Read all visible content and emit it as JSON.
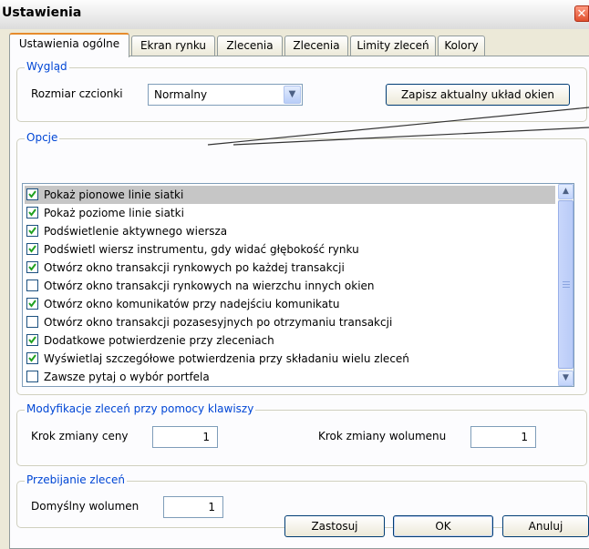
{
  "window": {
    "title": "Ustawienia",
    "close_glyph": "✕"
  },
  "tabs": [
    {
      "label": "Ustawienia ogólne",
      "active": true
    },
    {
      "label": "Ekran rynku",
      "active": false
    },
    {
      "label": "Zlecenia",
      "active": false
    },
    {
      "label": "Zlecenia",
      "active": false
    },
    {
      "label": "Limity zleceń",
      "active": false
    },
    {
      "label": "Kolory",
      "active": false
    }
  ],
  "wyglad": {
    "group_label": "Wygląd",
    "font_size_label": "Rozmiar czcionki",
    "font_size_value": "Normalny",
    "save_layout_label": "Zapisz aktualny układ okien"
  },
  "opcje": {
    "group_label": "Opcje",
    "items": [
      {
        "label": "Pokaż pionowe linie siatki",
        "checked": true,
        "selected": true
      },
      {
        "label": "Pokaż poziome linie siatki",
        "checked": true
      },
      {
        "label": "Podświetlenie aktywnego wiersza",
        "checked": true
      },
      {
        "label": "Podświetl wiersz instrumentu, gdy widać głębokość rynku",
        "checked": true
      },
      {
        "label": "Otwórz okno transakcji rynkowych po każdej transakcji",
        "checked": true
      },
      {
        "label": "Otwórz okno transakcji rynkowych na wierzchu innych okien",
        "checked": false
      },
      {
        "label": "Otwórz okno komunikatów przy nadejściu komunikatu",
        "checked": true
      },
      {
        "label": "Otwórz okno transakcji pozasesyjnych po otrzymaniu transakcji",
        "checked": false
      },
      {
        "label": "Dodatkowe potwierdzenie przy zleceniach",
        "checked": true
      },
      {
        "label": "Wyświetlaj szczegółowe potwierdzenia przy składaniu wielu zleceń",
        "checked": true
      },
      {
        "label": "Zawsze pytaj o wybór portfela",
        "checked": false
      }
    ]
  },
  "modyfikacje": {
    "group_label": "Modyfikacje zleceń przy pomocy klawiszy",
    "price_step_label": "Krok zmiany ceny",
    "price_step_value": "1",
    "volume_step_label": "Krok zmiany wolumenu",
    "volume_step_value": "1"
  },
  "przebijanie": {
    "group_label": "Przebijanie zleceń",
    "default_volume_label": "Domyślny wolumen",
    "default_volume_value": "1"
  },
  "footer": {
    "apply_label": "Zastosuj",
    "ok_label": "OK",
    "cancel_label": "Anuluj"
  },
  "colors": {
    "group_label_text": "#0046d5",
    "check_mark": "#21a121",
    "selected_row": "#c6c6c6"
  },
  "icons": {
    "dropdown": "chevron-down-icon",
    "scroll_up": "arrow-up-icon",
    "scroll_down": "arrow-down-icon",
    "checkbox_checked": "check-icon"
  }
}
